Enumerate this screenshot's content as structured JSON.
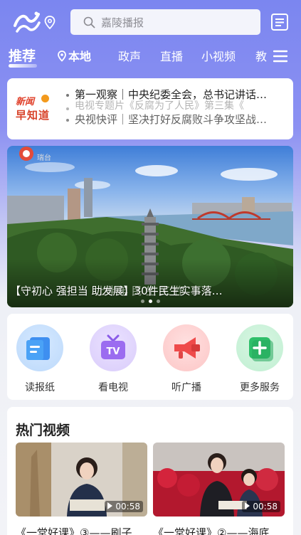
{
  "header": {
    "search_placeholder": "嘉陵播报"
  },
  "tabs": [
    {
      "label": "推荐"
    },
    {
      "label": "本地"
    },
    {
      "label": "政声"
    },
    {
      "label": "直播"
    },
    {
      "label": "小视频"
    },
    {
      "label": "教"
    }
  ],
  "ticker": {
    "brand_line1": "新闻",
    "brand_line2": "早知道",
    "lines": [
      "第一观察｜中央纪委全会，总书记讲话…",
      "电视专题片《反腐为了人民》第三集《",
      "央视快评｜坚决打好反腐败斗争攻坚战…"
    ]
  },
  "banner": {
    "badge_text": "瑞台",
    "caption": "【守初心 强担当 助发展】30件民生实事落…",
    "caption_ghost": "上半年 民 生 工 作",
    "slide_count": 3,
    "active_slide": 1
  },
  "services": [
    {
      "label": "读报纸",
      "icon": "newspaper-icon"
    },
    {
      "label": "看电视",
      "icon": "tv-icon"
    },
    {
      "label": "听广播",
      "icon": "megaphone-icon"
    },
    {
      "label": "更多服务",
      "icon": "plus-icon"
    }
  ],
  "hot_videos": {
    "title": "热门视频",
    "items": [
      {
        "title": "《一堂好课》③——刷子",
        "duration": "00:58"
      },
      {
        "title": "《一堂好课》②——海底",
        "duration": "00:58"
      }
    ]
  },
  "colors": {
    "header_gradient_top": "#7b86f0",
    "brand_red": "#d8432a"
  }
}
